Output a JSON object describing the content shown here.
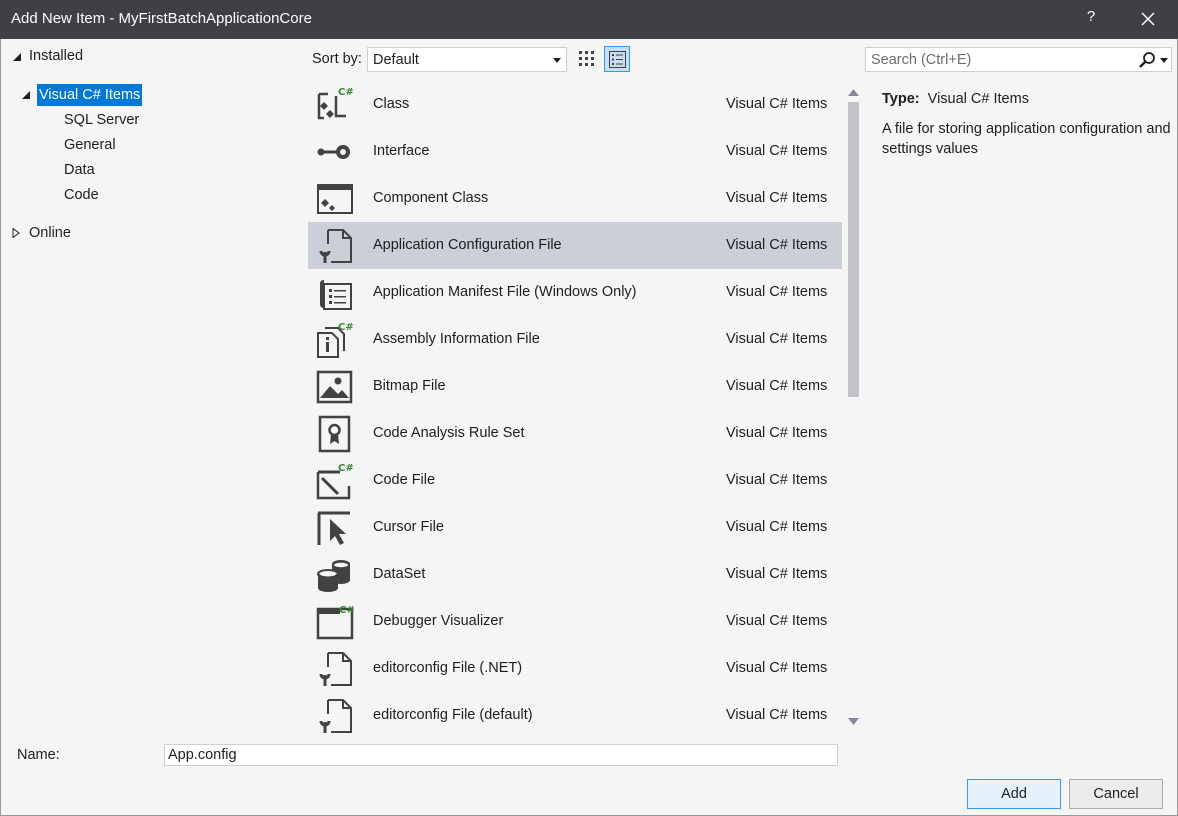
{
  "window": {
    "title": "Add New Item - MyFirstBatchApplicationCore",
    "help_label": "?"
  },
  "tree": {
    "installed": "Installed",
    "visual_csharp_items": "Visual C# Items",
    "children": [
      "SQL Server",
      "General",
      "Data",
      "Code"
    ],
    "online": "Online"
  },
  "toolbar": {
    "sort_label": "Sort by:",
    "sort_value": "Default"
  },
  "search": {
    "placeholder": "Search (Ctrl+E)"
  },
  "templates": [
    {
      "name": "Class",
      "category": "Visual C# Items",
      "icon": "class-icon"
    },
    {
      "name": "Interface",
      "category": "Visual C# Items",
      "icon": "interface-icon"
    },
    {
      "name": "Component Class",
      "category": "Visual C# Items",
      "icon": "component-class-icon"
    },
    {
      "name": "Application Configuration File",
      "category": "Visual C# Items",
      "icon": "config-file-icon",
      "selected": true
    },
    {
      "name": "Application Manifest File (Windows Only)",
      "category": "Visual C# Items",
      "icon": "manifest-file-icon"
    },
    {
      "name": "Assembly Information File",
      "category": "Visual C# Items",
      "icon": "assembly-info-icon"
    },
    {
      "name": "Bitmap File",
      "category": "Visual C# Items",
      "icon": "bitmap-icon"
    },
    {
      "name": "Code Analysis Rule Set",
      "category": "Visual C# Items",
      "icon": "rule-set-icon"
    },
    {
      "name": "Code File",
      "category": "Visual C# Items",
      "icon": "code-file-icon"
    },
    {
      "name": "Cursor File",
      "category": "Visual C# Items",
      "icon": "cursor-icon"
    },
    {
      "name": "DataSet",
      "category": "Visual C# Items",
      "icon": "dataset-icon"
    },
    {
      "name": "Debugger Visualizer",
      "category": "Visual C# Items",
      "icon": "debugger-visualizer-icon"
    },
    {
      "name": "editorconfig File (.NET)",
      "category": "Visual C# Items",
      "icon": "editorconfig-icon"
    },
    {
      "name": "editorconfig File (default)",
      "category": "Visual C# Items",
      "icon": "editorconfig-icon"
    }
  ],
  "details": {
    "type_label": "Type:",
    "type_value": "Visual C# Items",
    "description": "A file for storing application configuration and settings values"
  },
  "bottom": {
    "name_label": "Name:",
    "name_value": "App.config",
    "add_label": "Add",
    "cancel_label": "Cancel"
  },
  "colors": {
    "titlebar": "#3f3f46",
    "selection": "#0078d7",
    "row_selected": "#ccced8",
    "csharp_green": "#388a34"
  }
}
